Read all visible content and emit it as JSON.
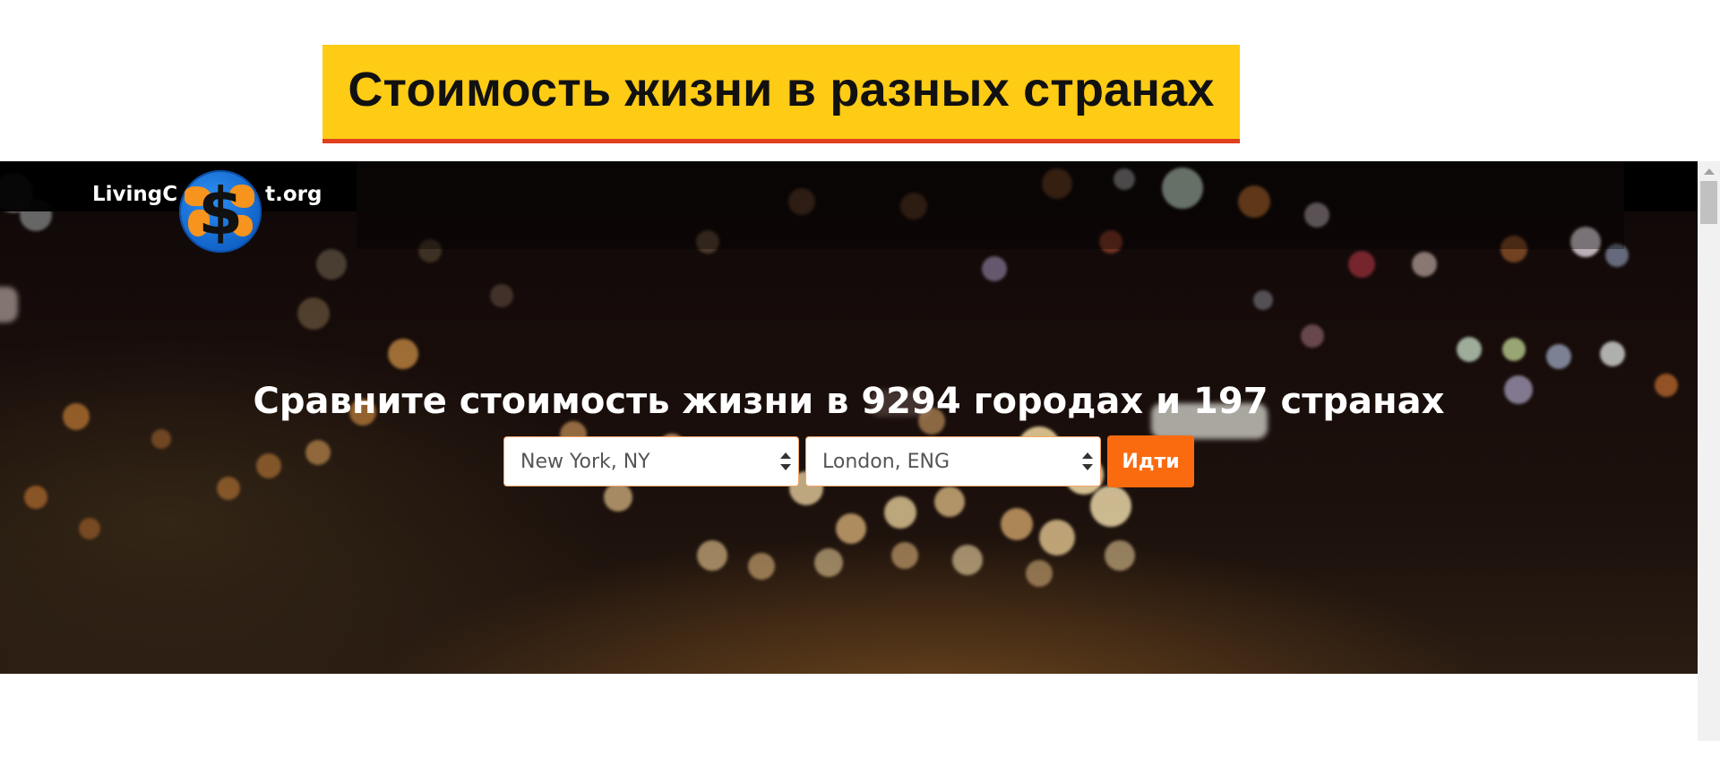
{
  "banner": {
    "title": "Стоимость жизни в разных странах"
  },
  "site": {
    "logo_left": "LivingC",
    "logo_right": "t.org",
    "logo_symbol": "$"
  },
  "hero": {
    "headline": "Сравните стоимость жизни в 9294 городах и 197 странах",
    "from_city": "New York, NY",
    "to_city": "London, ENG",
    "go_label": "Идти"
  },
  "colors": {
    "banner_bg": "#fecb15",
    "banner_underline": "#e1401c",
    "button_bg": "#fa6b10",
    "select_border": "#f2a46a"
  },
  "icons": {
    "logo": "globe-dollar-icon",
    "select_arrows": "updown-chevron-icon",
    "scroll_up": "scroll-up-arrow-icon"
  }
}
